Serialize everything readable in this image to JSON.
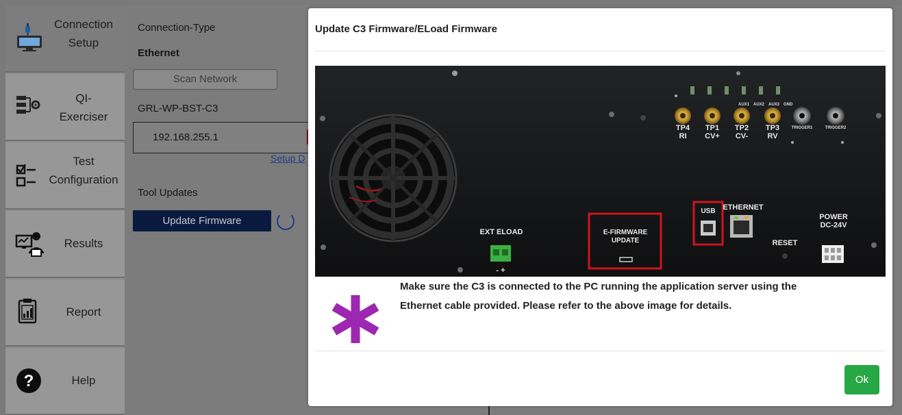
{
  "sidebar": {
    "items": [
      {
        "label": "Connection Setup",
        "icon": "computer-plug-icon",
        "active": true
      },
      {
        "label": "QI-Exerciser",
        "icon": "circuit-gear-icon"
      },
      {
        "label": "Test Configuration",
        "icon": "checklist-icon"
      },
      {
        "label": "Results",
        "icon": "user-monitor-icon"
      },
      {
        "label": "Report",
        "icon": "clipboard-chart-icon"
      },
      {
        "label": "Help",
        "icon": "question-circle-icon"
      }
    ]
  },
  "connection": {
    "type_label": "Connection-Type",
    "type_value": "Ethernet",
    "scan_button": "Scan Network",
    "device_name": "GRL-WP-BST-C3",
    "ip_value": "192.168.255.1",
    "setup_link": "Setup D",
    "tool_updates_label": "Tool Updates",
    "update_button": "Update Firmware"
  },
  "modal": {
    "title": "Update C3 Firmware/ELoad Firmware",
    "message": "Make sure the C3 is connected to the PC running the application server using the Ethernet cable provided. Please refer to the above image for details.",
    "ok_button": "Ok",
    "image": {
      "labels": {
        "tp4": "TP4",
        "ri": "RI",
        "tp1": "TP1",
        "cv_plus": "CV+",
        "tp2": "TP2",
        "cv_minus": "CV-",
        "tp3": "TP3",
        "rv": "RV",
        "aux1": "AUX1",
        "aux2": "AUX2",
        "aux3": "AUX3",
        "gnd": "GND",
        "trigger1": "TRIGGER1",
        "trigger2": "TRIGGER2",
        "ext_eload": "EXT ELOAD",
        "polarity": "- +",
        "e_firmware": "E-FIRMWARE",
        "update": "UPDATE",
        "usb": "USB",
        "ethernet": "ETHERNET",
        "reset": "RESET",
        "power": "POWER",
        "dc24v": "DC-24V"
      }
    }
  },
  "colors": {
    "accent_navy": "#0a1a3e",
    "ok_green": "#28a745",
    "highlight_red": "#d0141e",
    "asterisk_purple": "#9c27b0"
  }
}
